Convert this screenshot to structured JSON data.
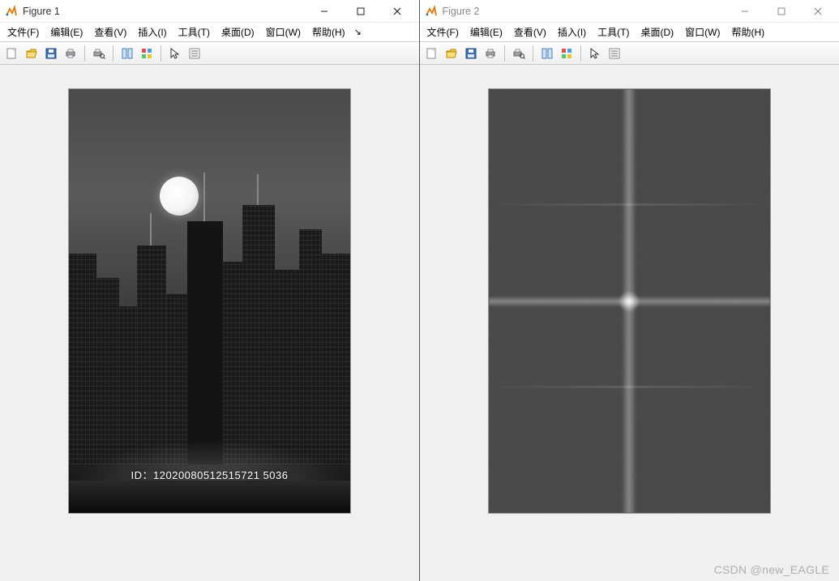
{
  "windows": [
    {
      "title": "Figure 1",
      "active": true,
      "image": {
        "kind": "city",
        "id_label": "ID：12020080512515721 5036"
      }
    },
    {
      "title": "Figure 2",
      "active": false,
      "image": {
        "kind": "fft"
      }
    }
  ],
  "menu": {
    "items": [
      "文件(F)",
      "编辑(E)",
      "查看(V)",
      "插入(I)",
      "工具(T)",
      "桌面(D)",
      "窗口(W)",
      "帮助(H)"
    ],
    "overflow_glyph": "↘"
  },
  "toolbar": {
    "icons": [
      "new-figure-icon",
      "open-icon",
      "save-icon",
      "print-icon",
      "sep",
      "print-preview-icon",
      "sep",
      "link-axes-icon",
      "insert-colorbar-icon",
      "sep",
      "pointer-icon",
      "data-cursor-icon"
    ]
  },
  "watermark": "CSDN @new_EAGLE"
}
